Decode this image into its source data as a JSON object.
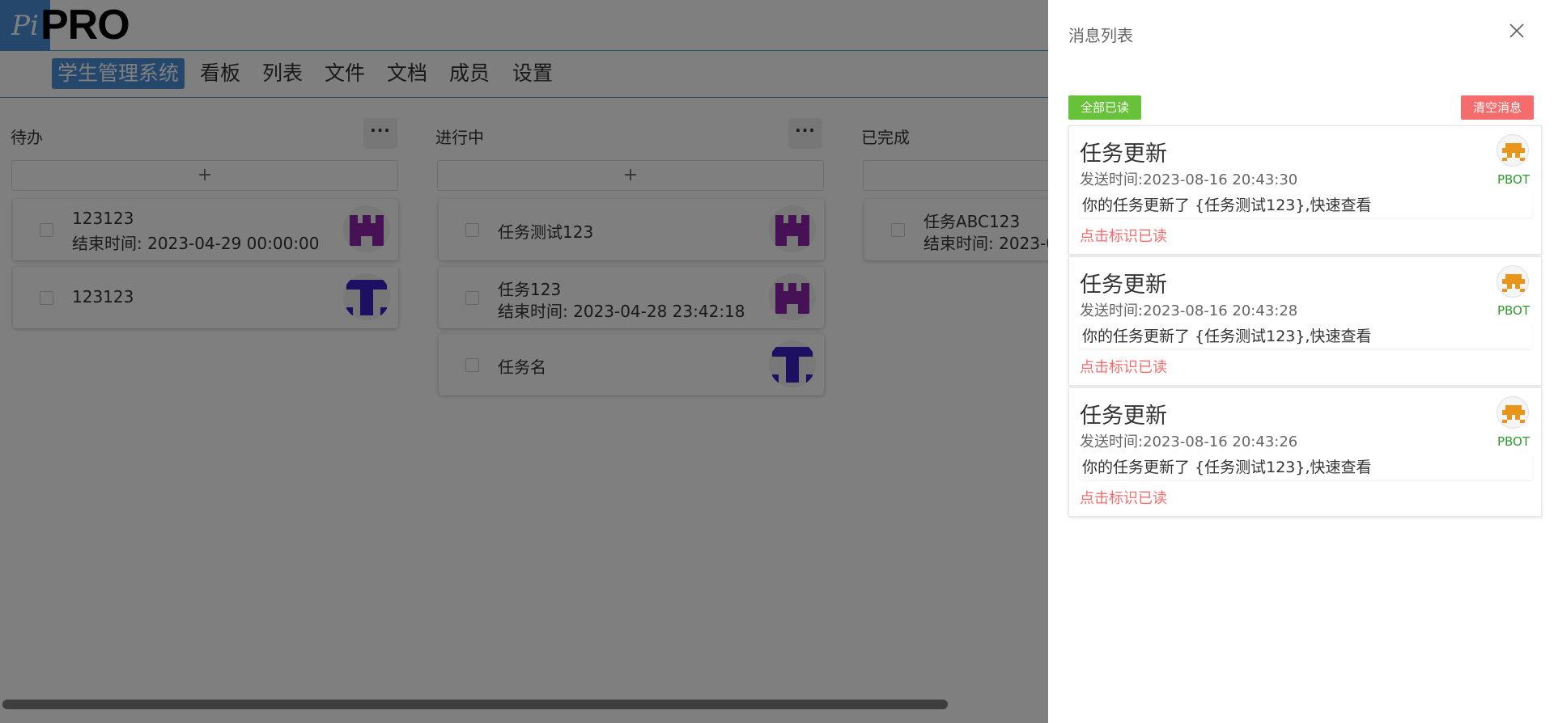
{
  "app": {
    "logo_text": "Pi",
    "title": "PRO"
  },
  "nav": {
    "items": [
      {
        "label": "学生管理系统",
        "active": true
      },
      {
        "label": "看板",
        "active": false
      },
      {
        "label": "列表",
        "active": false
      },
      {
        "label": "文件",
        "active": false
      },
      {
        "label": "文档",
        "active": false
      },
      {
        "label": "成员",
        "active": false
      },
      {
        "label": "设置",
        "active": false
      }
    ]
  },
  "board": {
    "columns": [
      {
        "title": "待办",
        "more_label": "···",
        "add_label": "+",
        "tasks": [
          {
            "name": "123123",
            "end_time": "结束时间: 2023-04-29 00:00:00",
            "avatar": "purple-castle-avatar"
          },
          {
            "name": "123123",
            "end_time": "",
            "avatar": "blue-t-avatar"
          }
        ]
      },
      {
        "title": "进行中",
        "more_label": "···",
        "add_label": "+",
        "tasks": [
          {
            "name": "任务测试123",
            "end_time": "",
            "avatar": "purple-castle-avatar"
          },
          {
            "name": "任务123",
            "end_time": "结束时间: 2023-04-28 23:42:18",
            "avatar": "purple-castle-avatar"
          },
          {
            "name": "任务名",
            "end_time": "",
            "avatar": "blue-t-avatar"
          }
        ]
      },
      {
        "title": "已完成",
        "add_label": "+",
        "tasks": [
          {
            "name": "任务ABC123",
            "end_time": "结束时间: 2023-0",
            "avatar": ""
          }
        ]
      }
    ]
  },
  "drawer": {
    "title": "消息列表",
    "close_icon": "close-icon",
    "read_all_label": "全部已读",
    "clear_label": "清空消息",
    "messages": [
      {
        "title": "任务更新",
        "time": "发送时间:2023-08-16 20:43:30",
        "body": "你的任务更新了 {任务测试123},快速查看",
        "mark_label": "点击标识已读",
        "sender": "PBOT"
      },
      {
        "title": "任务更新",
        "time": "发送时间:2023-08-16 20:43:28",
        "body": "你的任务更新了 {任务测试123},快速查看",
        "mark_label": "点击标识已读",
        "sender": "PBOT"
      },
      {
        "title": "任务更新",
        "time": "发送时间:2023-08-16 20:43:26",
        "body": "你的任务更新了 {任务测试123},快速查看",
        "mark_label": "点击标识已读",
        "sender": "PBOT"
      }
    ]
  },
  "colors": {
    "accent": "#4a8fd8",
    "success": "#67c23a",
    "danger": "#f56c6c",
    "sender": "#2b9a2b",
    "avatar_purple": "#8e24aa",
    "avatar_blue": "#3a1fc2",
    "robot_orange": "#e8961a"
  }
}
